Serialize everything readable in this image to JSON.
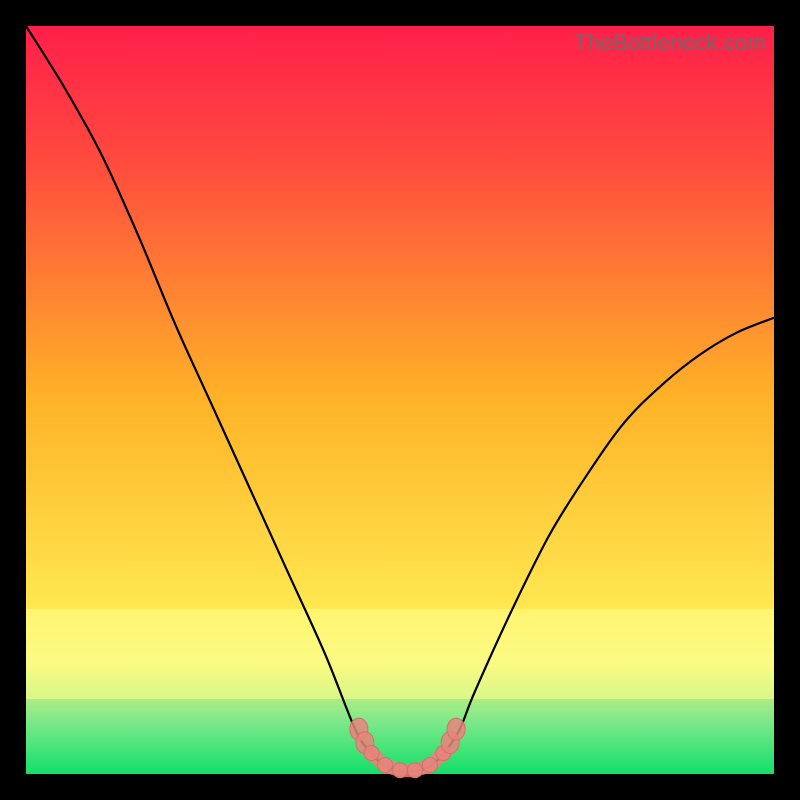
{
  "watermark": "TheBottleneck.com",
  "colors": {
    "top": "#ff1f4a",
    "upper": "#ff4a3e",
    "mid": "#ffb327",
    "lower": "#ffe851",
    "lower2": "#f7f57a",
    "band": "#ffff8a",
    "green1": "#7de88a",
    "green2": "#11e06a"
  },
  "chart_data": {
    "type": "line",
    "title": "",
    "xlabel": "",
    "ylabel": "",
    "xlim": [
      0,
      100
    ],
    "ylim": [
      0,
      100
    ],
    "x": [
      0,
      5,
      10,
      15,
      20,
      25,
      30,
      35,
      40,
      44,
      46,
      48,
      50,
      52,
      54,
      56,
      58,
      60,
      65,
      70,
      75,
      80,
      85,
      90,
      95,
      100
    ],
    "values": [
      100,
      92,
      83,
      72,
      60,
      49,
      38,
      27,
      16,
      6,
      3,
      1,
      0.4,
      0.4,
      1,
      3,
      6,
      11,
      22,
      32,
      40,
      47,
      52,
      56,
      59,
      61
    ],
    "series_name": "bottleneck-curve",
    "markers": {
      "x": [
        44.5,
        45.3,
        46.2,
        48.0,
        50.0,
        52.0,
        54.0,
        55.8,
        56.7,
        57.5
      ],
      "y": [
        6.0,
        4.2,
        2.8,
        1.2,
        0.5,
        0.5,
        1.2,
        2.8,
        4.2,
        6.0
      ]
    },
    "legend": false,
    "grid": false
  }
}
